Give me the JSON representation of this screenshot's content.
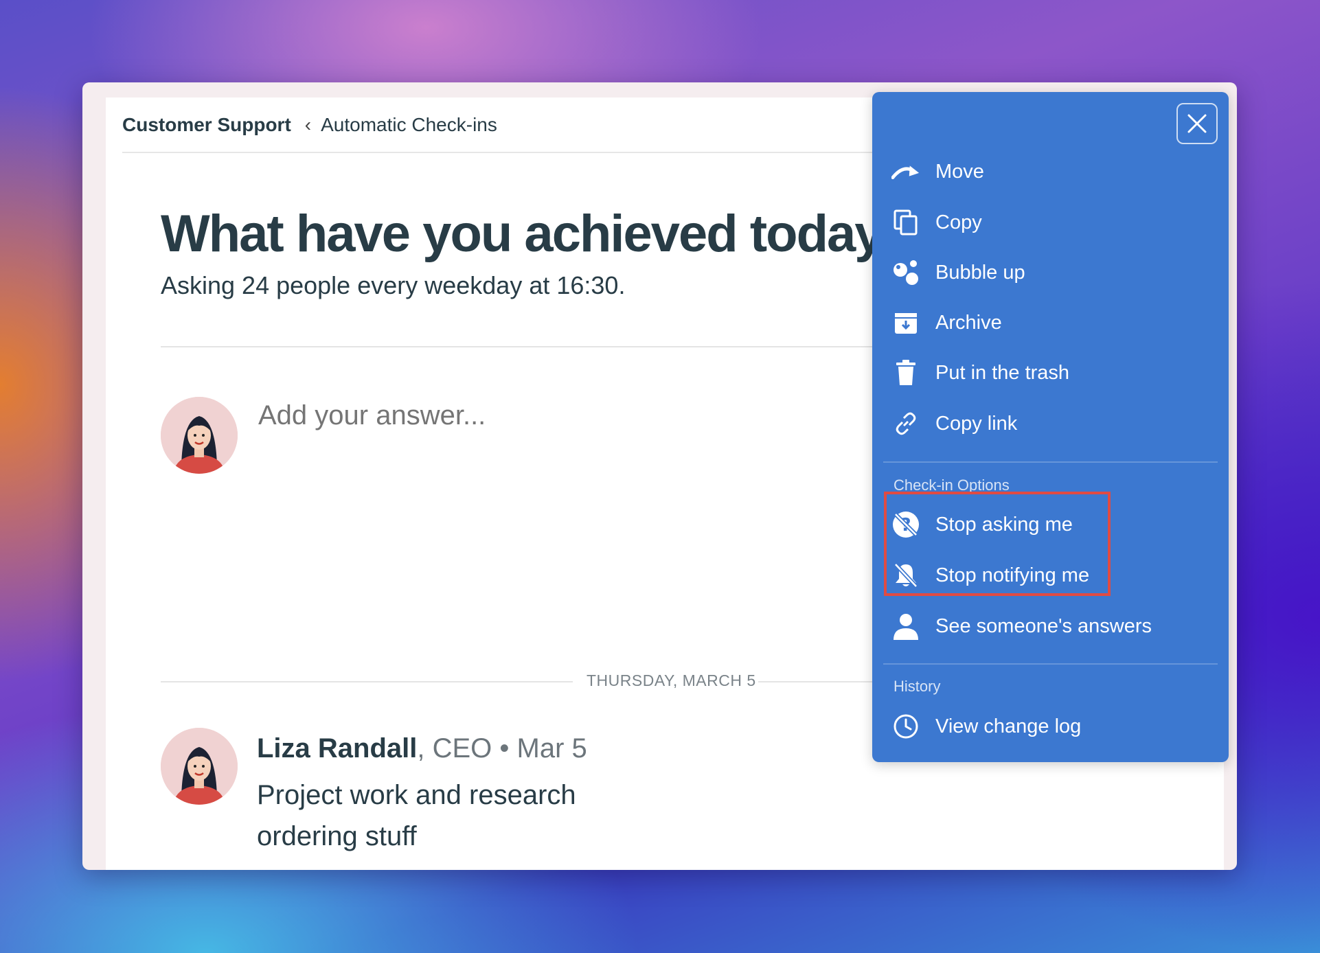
{
  "breadcrumb": {
    "project": "Customer Support",
    "separator": "‹",
    "tool": "Automatic Check-ins"
  },
  "question": {
    "title": "What have you achieved today?",
    "subtitle": "Asking 24 people every weekday at 16:30."
  },
  "answer_box": {
    "placeholder": "Add your answer..."
  },
  "date_divider": "THURSDAY, MARCH 5",
  "entry": {
    "name": "Liza Randall",
    "role": ", CEO",
    "dot": " • ",
    "date": "Mar 5",
    "line1": "Project work and research",
    "line2": "ordering stuff"
  },
  "menu": {
    "items": [
      {
        "label": "Move",
        "icon": "move-icon"
      },
      {
        "label": "Copy",
        "icon": "copy-icon"
      },
      {
        "label": "Bubble up",
        "icon": "bubble-up-icon"
      },
      {
        "label": "Archive",
        "icon": "archive-icon"
      },
      {
        "label": "Put in the trash",
        "icon": "trash-icon"
      },
      {
        "label": "Copy link",
        "icon": "link-icon"
      }
    ],
    "checkin_heading": "Check-in Options",
    "checkin_items": [
      {
        "label": "Stop asking me",
        "icon": "stop-asking-icon"
      },
      {
        "label": "Stop notifying me",
        "icon": "bell-off-icon"
      },
      {
        "label": "See someone's answers",
        "icon": "person-icon"
      }
    ],
    "history_heading": "History",
    "history_items": [
      {
        "label": "View change log",
        "icon": "clock-icon"
      }
    ]
  },
  "colors": {
    "menu_bg": "#3c78d0",
    "highlight": "#e04b43",
    "text_dark": "#283c46"
  }
}
